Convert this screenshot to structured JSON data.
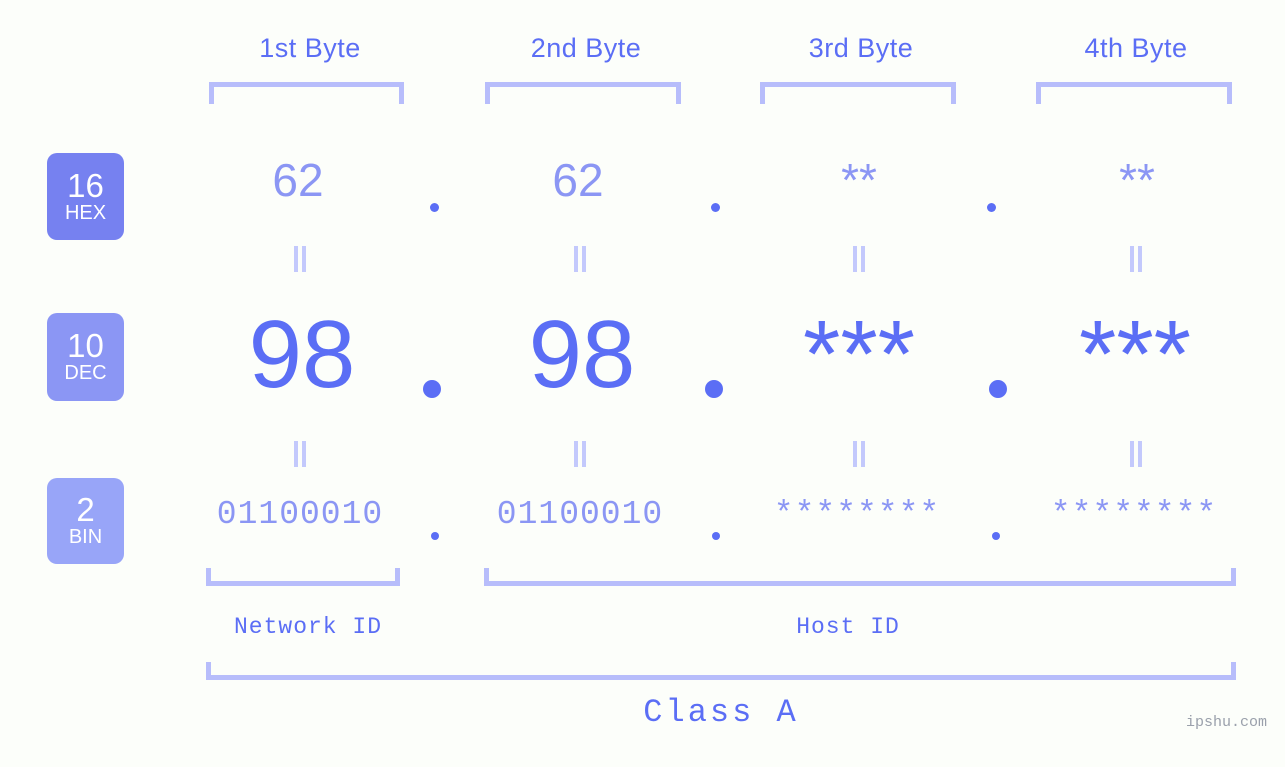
{
  "background_color": "#fcfefa",
  "accent_color": "#5b6ef5",
  "accent_light": "#8b96f4",
  "bracket_color": "#b7bdfb",
  "byte_headers": [
    {
      "label": "1st Byte"
    },
    {
      "label": "2nd Byte"
    },
    {
      "label": "3rd Byte"
    },
    {
      "label": "4th Byte"
    }
  ],
  "radix_rows": [
    {
      "badge_number": "16",
      "badge_name": "HEX",
      "badge_color": "#7681f0",
      "values": [
        "62",
        "62",
        "**",
        "**"
      ],
      "separator": "."
    },
    {
      "badge_number": "10",
      "badge_name": "DEC",
      "badge_color": "#8b96f4",
      "values": [
        "98",
        "98",
        "***",
        "***"
      ],
      "separator": "."
    },
    {
      "badge_number": "2",
      "badge_name": "BIN",
      "badge_color": "#98a5f8",
      "values": [
        "01100010",
        "01100010",
        "********",
        "********"
      ],
      "separator": "."
    }
  ],
  "equality_mark": "=",
  "footer": {
    "network_id_label": "Network ID",
    "host_id_label": "Host ID",
    "class_label": "Class A"
  },
  "watermark": "ipshu.com"
}
